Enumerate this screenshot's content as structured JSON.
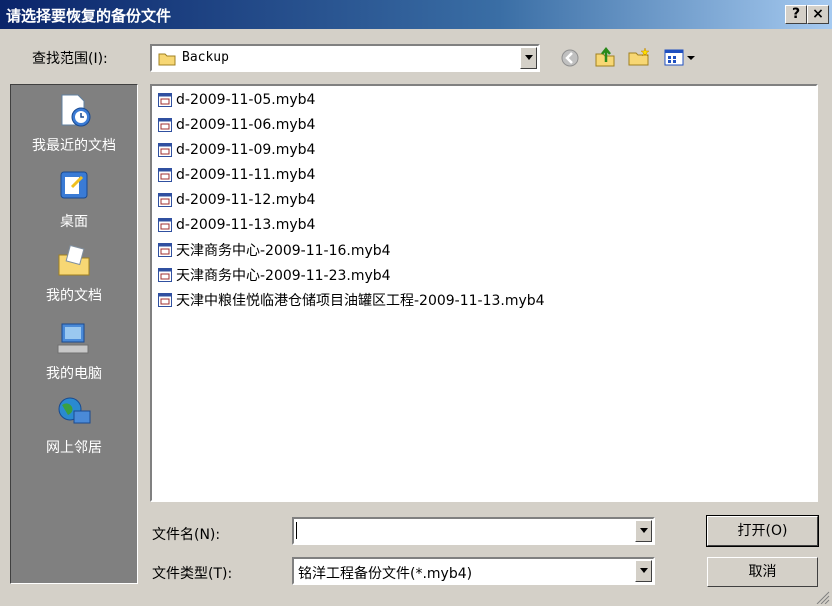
{
  "window": {
    "title": "请选择要恢复的备份文件",
    "help_label": "?",
    "close_label": "×"
  },
  "toolbar": {
    "lookin_label": "查找范围(I):",
    "lookin_value": "Backup",
    "icons": [
      "back-icon",
      "up-folder-icon",
      "new-folder-icon",
      "views-menu-icon"
    ]
  },
  "places": [
    {
      "label": "我最近的文档",
      "icon": "recent-documents-icon"
    },
    {
      "label": "桌面",
      "icon": "desktop-icon"
    },
    {
      "label": "我的文档",
      "icon": "my-documents-icon"
    },
    {
      "label": "我的电脑",
      "icon": "my-computer-icon"
    },
    {
      "label": "网上邻居",
      "icon": "network-places-icon"
    }
  ],
  "files": [
    "d-2009-11-05.myb4",
    "d-2009-11-06.myb4",
    "d-2009-11-09.myb4",
    "d-2009-11-11.myb4",
    "d-2009-11-12.myb4",
    "d-2009-11-13.myb4",
    "天津商务中心-2009-11-16.myb4",
    "天津商务中心-2009-11-23.myb4",
    "天津中粮佳悦临港仓储项目油罐区工程-2009-11-13.myb4"
  ],
  "footer": {
    "filename_label": "文件名(N):",
    "filename_value": "",
    "filetype_label": "文件类型(T):",
    "filetype_value": "铭洋工程备份文件(*.myb4)",
    "open_button": "打开(O)",
    "cancel_button": "取消"
  }
}
